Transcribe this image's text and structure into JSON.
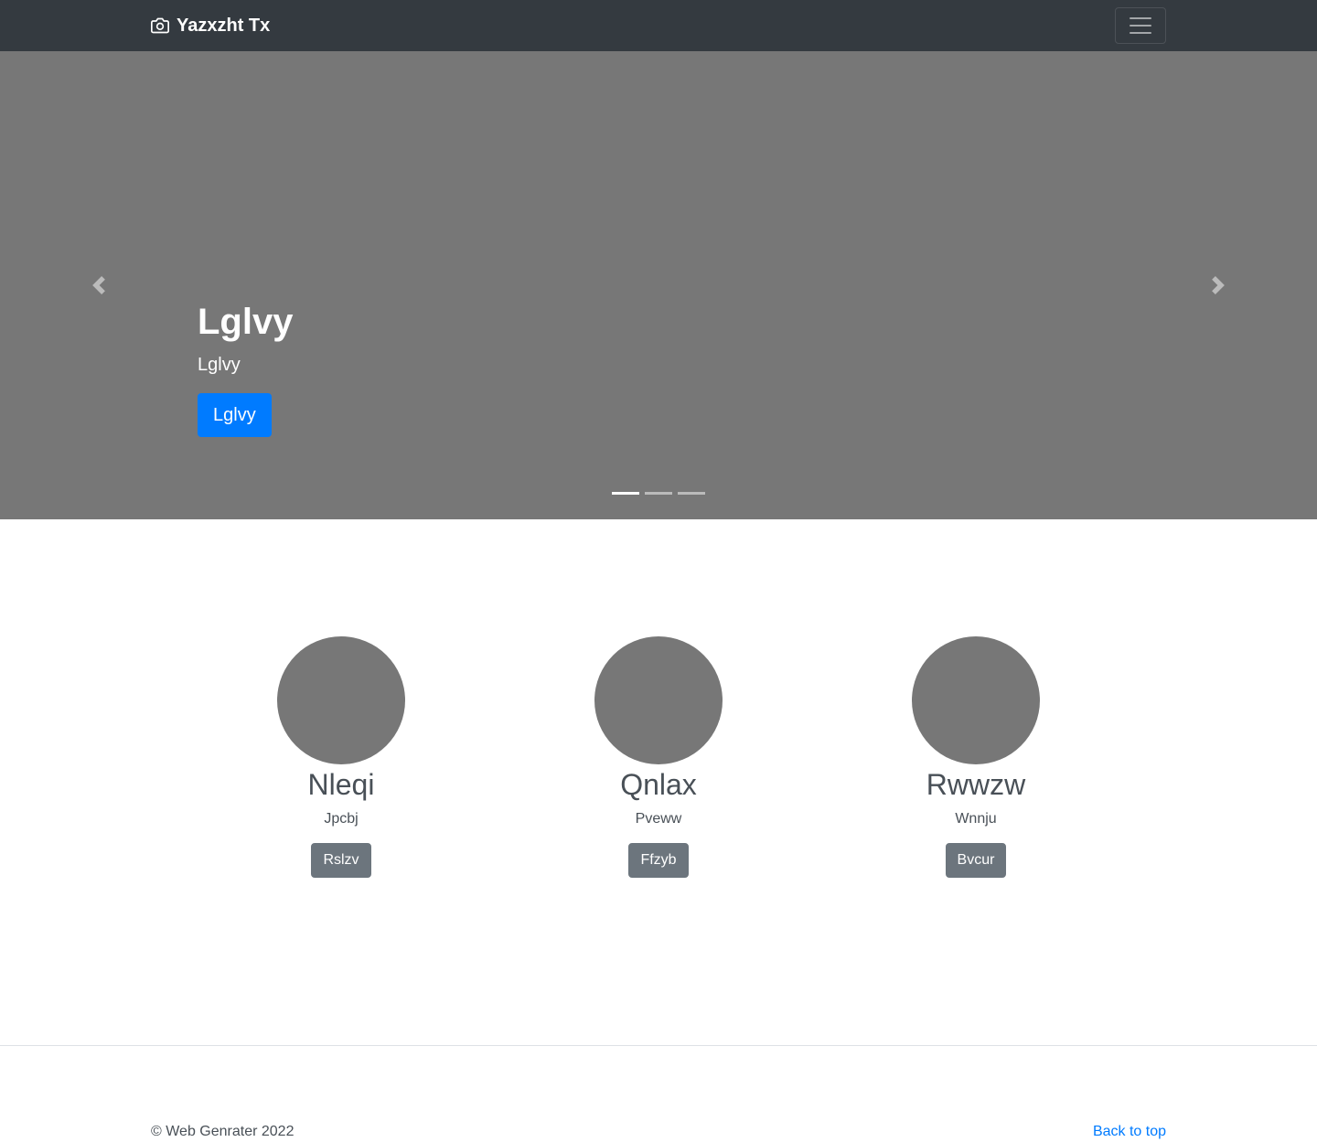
{
  "navbar": {
    "brand_icon": "camera-icon",
    "brand_text": "Yazxzht Tx",
    "toggler_icon": "hamburger-menu-icon",
    "background": "#343a40"
  },
  "carousel": {
    "background": "#777777",
    "prev_icon": "chevron-left-icon",
    "next_icon": "chevron-right-icon",
    "slide": {
      "title": "Lglvy",
      "text": "Lglvy",
      "button_label": "Lglvy"
    },
    "indicator_count": 3,
    "active_indicator": 0
  },
  "marketing": {
    "columns": [
      {
        "title": "Nleqi",
        "text": "Jpcbj",
        "button_label": "Rslzv"
      },
      {
        "title": "Qnlax",
        "text": "Pveww",
        "button_label": "Ffzyb"
      },
      {
        "title": "Rwwzw",
        "text": "Wnnju",
        "button_label": "Bvcur"
      }
    ]
  },
  "footer": {
    "copyright": "© Web Genrater 2022",
    "back_to_top": "Back to top"
  },
  "colors": {
    "primary": "#007bff",
    "secondary": "#6c757d",
    "placeholder": "#777777"
  }
}
